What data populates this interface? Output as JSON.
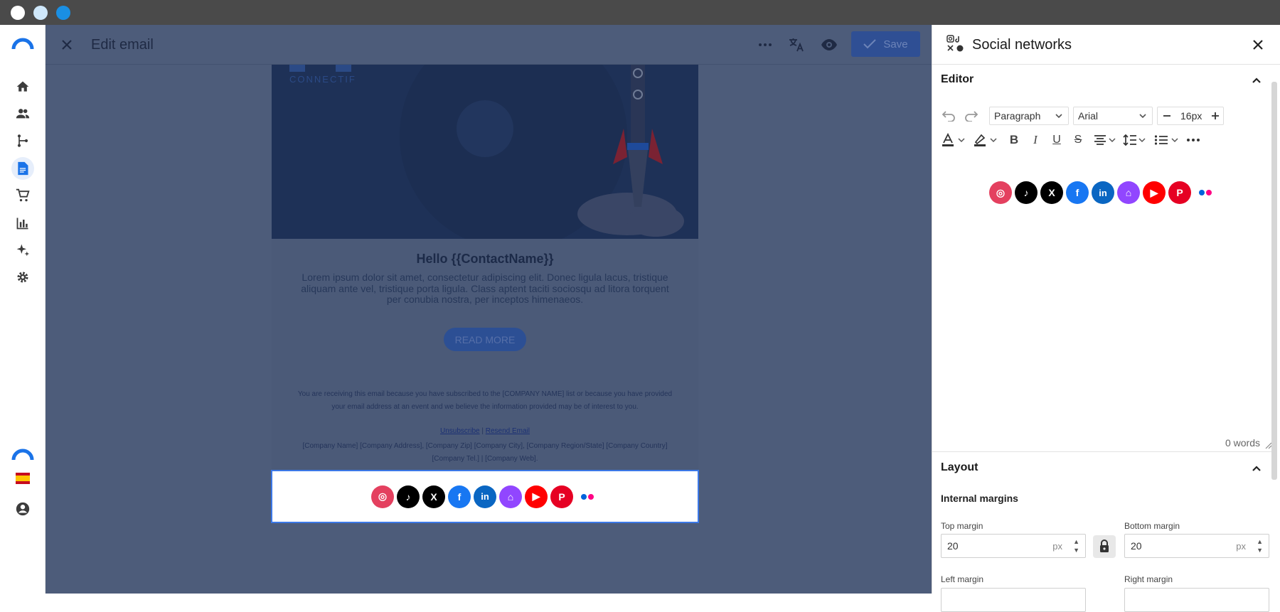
{
  "header": {
    "title": "Edit email",
    "save_label": "Save"
  },
  "email": {
    "greeting": "Hello {{ContactName}}",
    "body": "Lorem ipsum dolor sit amet, consectetur adipiscing elit. Donec ligula lacus, tristique aliquam ante vel, tristique porta ligula. Class aptent taciti sociosqu ad litora torquent per conubia nostra, per inceptos himenaeos.",
    "read_more": "READ MORE",
    "footer_notice": "You are receiving this email because you have subscribed to the [COMPANY NAME] list or because you have provided your email address at an event and we believe the information provided may be of interest to you.",
    "unsubscribe": "Unsubscribe",
    "link_separator": "|",
    "resend": "Resend Email",
    "address": "[Company Name] [Company Address], [Company Zip] [Company City], [Company Region/State] [Company Country] [Company Tel.] | [Company Web].",
    "logo_text": "CONNECTIF"
  },
  "social_networks": [
    {
      "name": "instagram",
      "color": "#e4405f",
      "glyph": "◎"
    },
    {
      "name": "tiktok",
      "color": "#000000",
      "glyph": "♪"
    },
    {
      "name": "x",
      "color": "#000000",
      "glyph": "X"
    },
    {
      "name": "facebook",
      "color": "#1877f2",
      "glyph": "f"
    },
    {
      "name": "linkedin",
      "color": "#0a66c2",
      "glyph": "in"
    },
    {
      "name": "twitch",
      "color": "#9146ff",
      "glyph": "⌂"
    },
    {
      "name": "youtube",
      "color": "#ff0000",
      "glyph": "▶"
    },
    {
      "name": "pinterest",
      "color": "#e60023",
      "glyph": "P"
    }
  ],
  "panel": {
    "title": "Social networks",
    "editor_section": "Editor",
    "paragraph_select": "Paragraph",
    "font_select": "Arial",
    "font_size": "16px",
    "word_count": "0 words",
    "layout_section": "Layout",
    "internal_margins": "Internal margins",
    "top_margin_label": "Top margin",
    "top_margin_value": "20",
    "bottom_margin_label": "Bottom margin",
    "bottom_margin_value": "20",
    "left_margin_label": "Left margin",
    "right_margin_label": "Right margin",
    "unit": "px"
  },
  "colors": {
    "accent": "#2f4f94",
    "overlay": "#4d5c7a",
    "selection": "#3b78e7",
    "flickr_blue": "#0063dc",
    "flickr_pink": "#ff0084"
  }
}
